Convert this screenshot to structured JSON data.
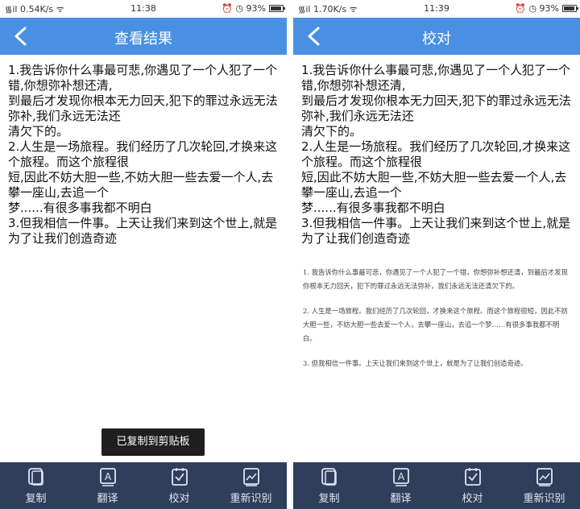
{
  "screens": [
    {
      "status": {
        "signal": "᯾il 0.54K/s ᯤ",
        "time": "11:38",
        "right": "⏰ ◷ 93%"
      },
      "title": "查看结果",
      "text": "1.我告诉你什么事最可悲,你遇见了一个人犯了一个错,你想弥补想还清,\n到最后才发现你根本无力回天,犯下的罪过永远无法弥补,我们永远无法还\n清欠下的。\n2.人生是一场旅程。我们经历了几次轮回,才换来这个旅程。而这个旅程很\n短,因此不妨大胆一些,不妨大胆一些去爱一个人,去攀一座山,去追一个\n梦......有很多事我都不明白\n3.但我相信一件事。上天让我们来到这个世上,就是为了让我们创造奇迹",
      "toast": "已复制到剪贴板",
      "toolbar": [
        "复制",
        "翻译",
        "校对",
        "重新识别"
      ]
    },
    {
      "status": {
        "signal": "᯾il 1.70K/s ᯤ",
        "time": "11:39",
        "right": "⏰ ◷ 93%"
      },
      "title": "校对",
      "text": "1.我告诉你什么事最可悲,你遇见了一个人犯了一个错,你想弥补想还清,\n到最后才发现你根本无力回天,犯下的罪过永远无法弥补,我们永远无法还\n清欠下的。\n2.人生是一场旅程。我们经历了几次轮回,才换来这个旅程。而这个旅程很\n短,因此不妨大胆一些,不妨大胆一些去爱一个人,去攀一座山,去追一个\n梦......有很多事我都不明白\n3.但我相信一件事。上天让我们来到这个世上,就是为了让我们创造奇迹",
      "doc_paragraphs": [
        "1. 我告诉你什么事最可悲，你遇见了一个人犯了一个错，你想弥补想还清，到最后才发现你根本无力回天，犯下的罪过永远无法弥补，我们永远无法还清欠下的。",
        "2. 人生是一场旅程。我们经历了几次轮回，才换来这个旅程。而这个旅程很短，因此不妨大胆一些，不妨大胆一些去爱一个人，去攀一座山，去追一个梦……有很多事我都不明白。",
        "3. 但我相信一件事。上天让我们来到这个世上，就是为了让我们创造奇迹。"
      ],
      "toolbar": [
        "复制",
        "翻译",
        "校对",
        "重新识别"
      ]
    }
  ],
  "colors": {
    "title_bar": "#4a90e2",
    "bottom_bar": "#2f3e5a",
    "toast": "#1f1f1f"
  },
  "icons": [
    "back-arrow-icon",
    "copy-icon",
    "translate-icon",
    "proofread-icon",
    "re-recognize-icon"
  ]
}
